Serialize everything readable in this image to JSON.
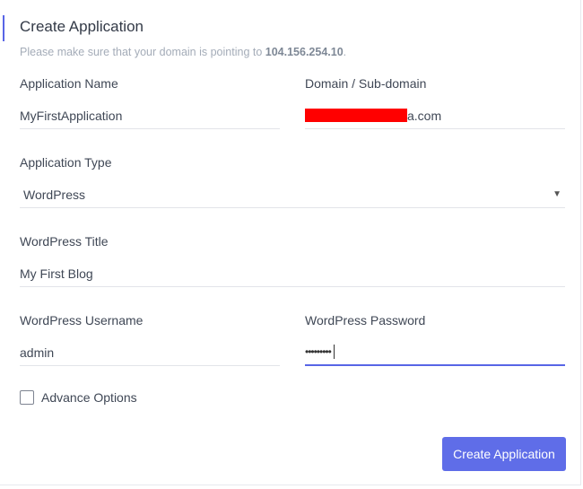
{
  "form": {
    "title": "Create Application",
    "subtitle_prefix": "Please make sure that your domain is pointing to ",
    "ip_address": "104.156.254.10",
    "subtitle_suffix": ".",
    "app_name_label": "Application Name",
    "app_name_value": "MyFirstApplication",
    "domain_label": "Domain / Sub-domain",
    "domain_visible_suffix": "a.com",
    "app_type_label": "Application Type",
    "app_type_value": "WordPress",
    "wp_title_label": "WordPress Title",
    "wp_title_value": "My First Blog",
    "wp_username_label": "WordPress Username",
    "wp_username_value": "admin",
    "wp_password_label": "WordPress Password",
    "wp_password_masked": "•••••••••",
    "advance_options_label": "Advance Options",
    "advance_options_checked": false,
    "submit_label": "Create Application"
  },
  "colors": {
    "accent": "#5865e6",
    "button": "#5f6de8",
    "redaction": "#ff0000"
  }
}
